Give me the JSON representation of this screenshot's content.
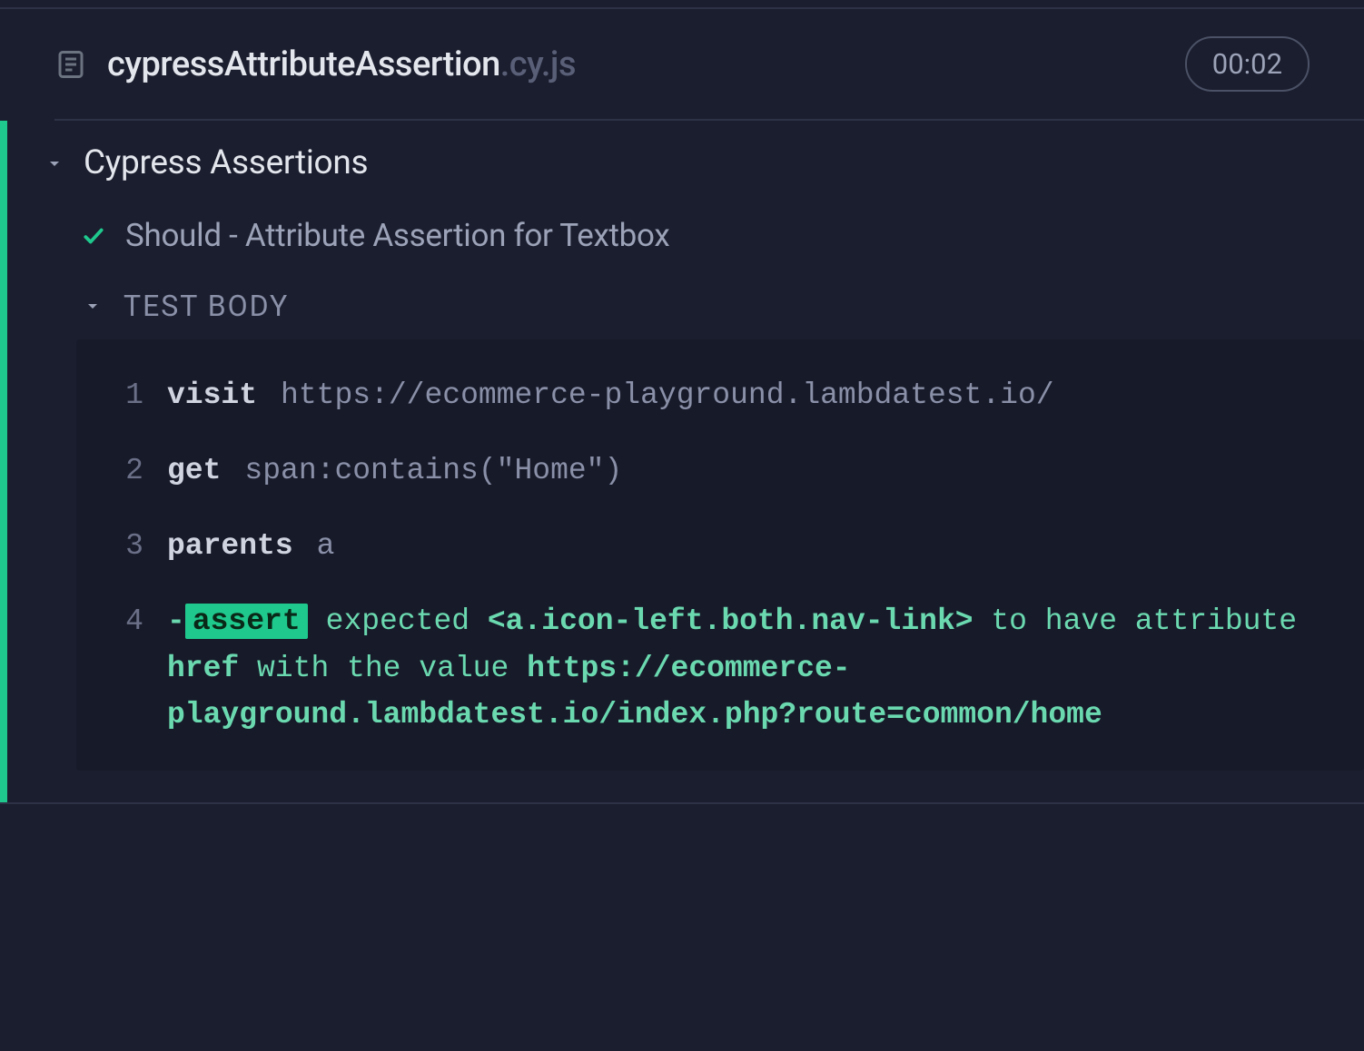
{
  "header": {
    "spec_name": "cypressAttributeAssertion",
    "spec_ext": ".cy.js",
    "timer": "00:02"
  },
  "suite": {
    "title": "Cypress Assertions",
    "test": {
      "title": "Should - Attribute Assertion for Textbox",
      "body_label": "TEST BODY"
    }
  },
  "commands": [
    {
      "num": "1",
      "name": "visit",
      "args": "https://ecommerce-playground.lambdatest.io/"
    },
    {
      "num": "2",
      "name": "get",
      "args": "span:contains(\"Home\")"
    },
    {
      "num": "3",
      "name": "parents",
      "args": "a"
    }
  ],
  "assertion": {
    "num": "4",
    "dash": "-",
    "pill": "assert",
    "expected": "expected ",
    "selector": "<a.icon-left.both.nav-link>",
    "to_have": " to have attribute ",
    "attr": "href",
    "with_value": " with the value ",
    "value": "https://ecommerce-playground.lambdatest.io/index.php?route=common/home"
  }
}
